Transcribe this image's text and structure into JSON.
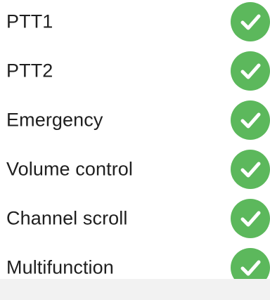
{
  "status_color": "#5cb85c",
  "items": [
    {
      "label": "PTT1",
      "status_icon": "check-circle-icon"
    },
    {
      "label": "PTT2",
      "status_icon": "check-circle-icon"
    },
    {
      "label": "Emergency",
      "status_icon": "check-circle-icon"
    },
    {
      "label": "Volume control",
      "status_icon": "check-circle-icon"
    },
    {
      "label": "Channel scroll",
      "status_icon": "check-circle-icon"
    },
    {
      "label": "Multifunction",
      "status_icon": "check-circle-icon"
    }
  ]
}
